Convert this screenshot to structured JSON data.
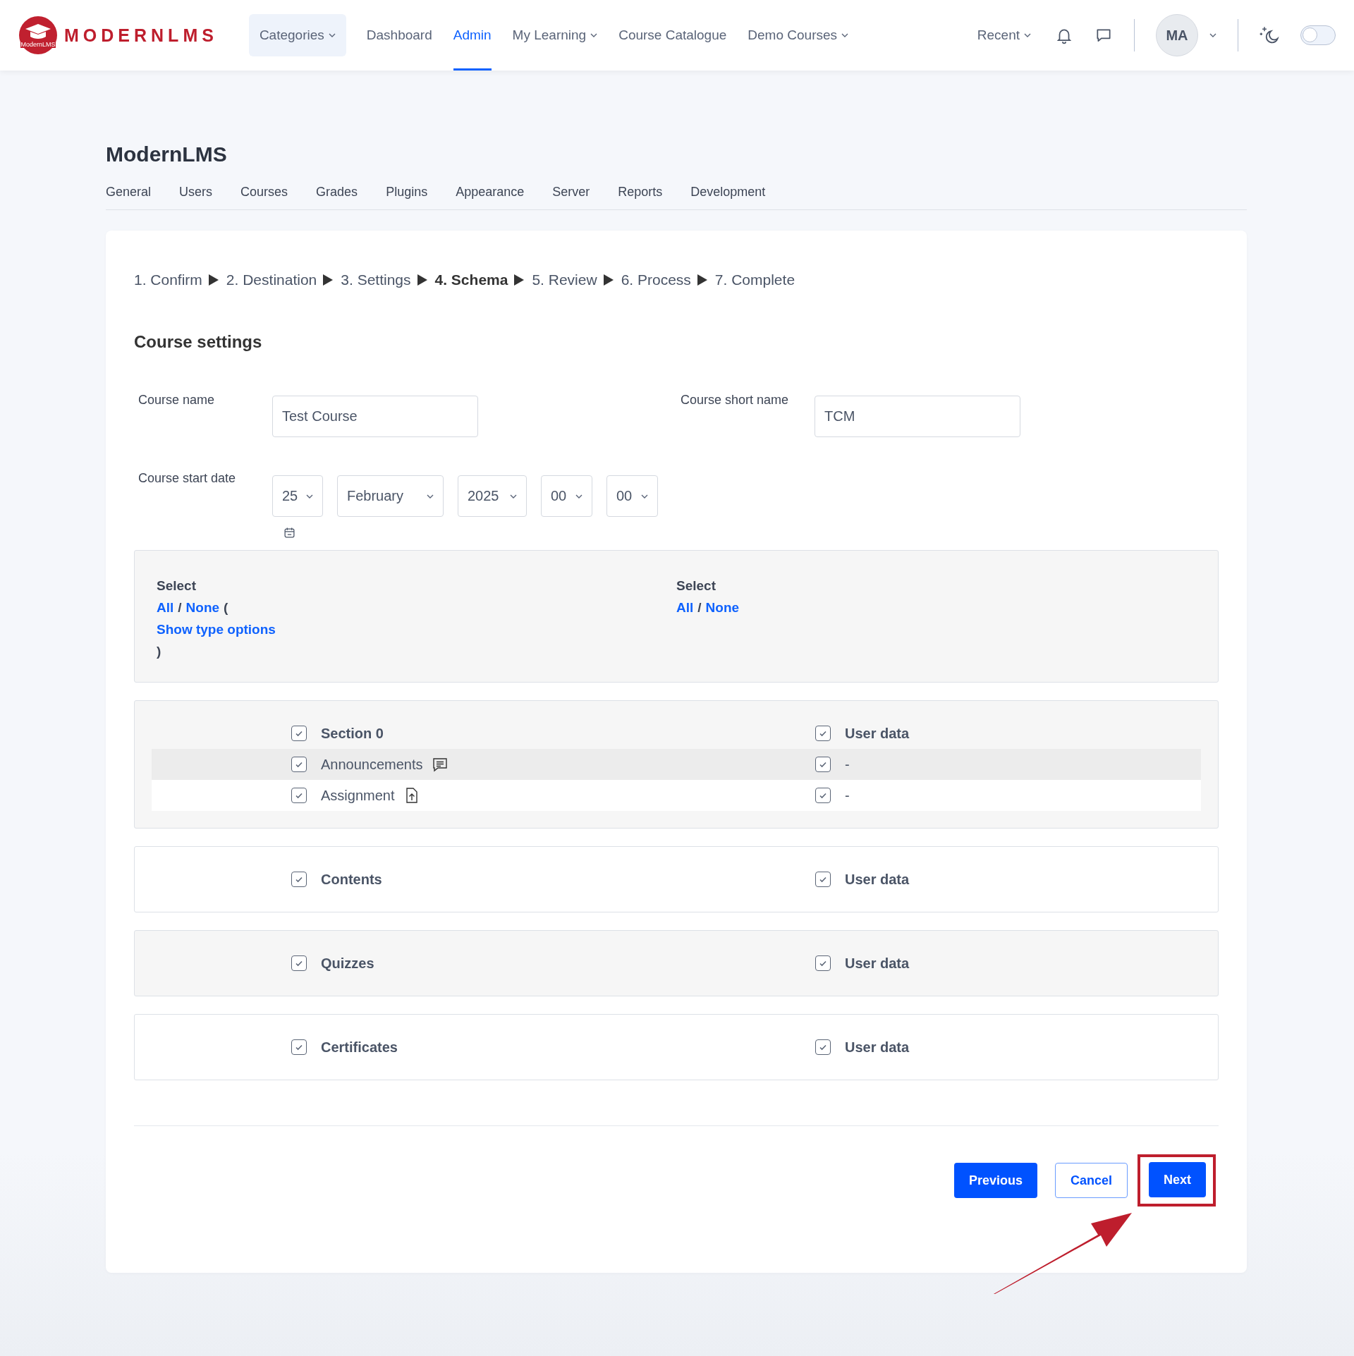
{
  "header": {
    "logo": {
      "wordmark": "MODERNLMS",
      "badge": "ModernLMS"
    },
    "nav": [
      {
        "label": "Categories",
        "kind": "pill",
        "dropdown": true,
        "selected": false
      },
      {
        "label": "Dashboard",
        "kind": "link",
        "dropdown": false,
        "selected": false
      },
      {
        "label": "Admin",
        "kind": "link",
        "dropdown": false,
        "selected": true
      },
      {
        "label": "My Learning",
        "kind": "link",
        "dropdown": true,
        "selected": false
      },
      {
        "label": "Course Catalogue",
        "kind": "link",
        "dropdown": false,
        "selected": false
      },
      {
        "label": "Demo Courses",
        "kind": "link",
        "dropdown": true,
        "selected": false
      }
    ],
    "recent": "Recent",
    "avatar": "MA",
    "dark_mode": {
      "on": false
    }
  },
  "page": {
    "title": "ModernLMS",
    "tabs": [
      "General",
      "Users",
      "Courses",
      "Grades",
      "Plugins",
      "Appearance",
      "Server",
      "Reports",
      "Development"
    ]
  },
  "steps": [
    {
      "label": "1. Confirm",
      "selected": false
    },
    {
      "label": "2. Destination",
      "selected": false
    },
    {
      "label": "3. Settings",
      "selected": false
    },
    {
      "label": "4. Schema",
      "selected": true
    },
    {
      "label": "5. Review",
      "selected": false
    },
    {
      "label": "6. Process",
      "selected": false
    },
    {
      "label": "7. Complete",
      "selected": false
    }
  ],
  "section_title": "Course settings",
  "fields": [
    {
      "label": "Course name",
      "value": "Test Course"
    },
    {
      "label": "Course short name",
      "value": "TCM"
    }
  ],
  "start_date": {
    "label": "Course start date",
    "selects": [
      "25",
      "February",
      "2025",
      "00",
      "00"
    ]
  },
  "select_all": [
    {
      "heading": "Select",
      "lines": [
        [
          {
            "text": "All",
            "kind": "link"
          },
          {
            "text": "/",
            "kind": "text"
          },
          {
            "text": "None",
            "kind": "link"
          },
          {
            "text": "(",
            "kind": "text"
          }
        ],
        [
          {
            "text": "Show type options",
            "kind": "link"
          }
        ],
        [
          {
            "text": ")",
            "kind": "text"
          }
        ]
      ]
    },
    {
      "heading": "Select",
      "lines": [
        [
          {
            "text": "All",
            "kind": "link"
          },
          {
            "text": "/",
            "kind": "text"
          },
          {
            "text": "None",
            "kind": "link"
          }
        ]
      ]
    }
  ],
  "sections": [
    {
      "rows": [
        {
          "kind": "section",
          "label": "Section 0",
          "checked": true,
          "userdata": "User data",
          "userdata_checked": true
        },
        {
          "kind": "forum",
          "label": "Announcements",
          "checked": true,
          "userdata": "-",
          "userdata_checked": true
        },
        {
          "kind": "assignment",
          "label": "Assignment",
          "checked": true,
          "userdata": "-",
          "userdata_checked": true
        }
      ]
    },
    {
      "rows": [
        {
          "kind": "section",
          "label": "Contents",
          "checked": true,
          "userdata": "User data",
          "userdata_checked": true
        }
      ]
    },
    {
      "rows": [
        {
          "kind": "section",
          "label": "Quizzes",
          "checked": true,
          "userdata": "User data",
          "userdata_checked": true
        }
      ]
    },
    {
      "rows": [
        {
          "kind": "section",
          "label": "Certificates",
          "checked": true,
          "userdata": "User data",
          "userdata_checked": true
        }
      ]
    }
  ],
  "buttons": [
    {
      "label": "Previous",
      "kind": "primary",
      "highlighted": false
    },
    {
      "label": "Cancel",
      "kind": "outline",
      "highlighted": false
    },
    {
      "label": "Next",
      "kind": "primary",
      "highlighted": true
    }
  ]
}
